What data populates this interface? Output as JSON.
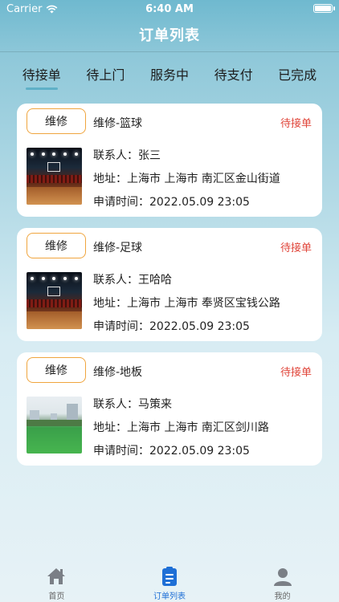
{
  "status_bar": {
    "carrier": "Carrier",
    "time": "6:40 AM"
  },
  "nav": {
    "title": "订单列表"
  },
  "tabs": [
    {
      "label": "待接单",
      "active": true
    },
    {
      "label": "待上门",
      "active": false
    },
    {
      "label": "服务中",
      "active": false
    },
    {
      "label": "待支付",
      "active": false
    },
    {
      "label": "已完成",
      "active": false
    }
  ],
  "orders": [
    {
      "type_label": "维修",
      "title": "维修-篮球",
      "status": "待接单",
      "contact": "联系人：张三",
      "address": "地址：上海市 上海市 南汇区金山街道",
      "time": "申请时间：2022.05.09 23:05",
      "image": "basketball-arena"
    },
    {
      "type_label": "维修",
      "title": "维修-足球",
      "status": "待接单",
      "contact": "联系人：王哈哈",
      "address": "地址：上海市 上海市 奉贤区宝钱公路",
      "time": "申请时间：2022.05.09 23:05",
      "image": "basketball-arena"
    },
    {
      "type_label": "维修",
      "title": "维修-地板",
      "status": "待接单",
      "contact": "联系人：马策来",
      "address": "地址：上海市 上海市 南汇区剑川路",
      "time": "申请时间：2022.05.09 23:05",
      "image": "football-field"
    }
  ],
  "tabbar": [
    {
      "label": "首页",
      "icon": "home-icon"
    },
    {
      "label": "订单列表",
      "icon": "order-list-icon",
      "active": true
    },
    {
      "label": "我的",
      "icon": "profile-icon"
    }
  ],
  "colors": {
    "accent": "#5fb0c7",
    "status": "#e0453a",
    "type_border": "#f0a53e",
    "tab_active": "#1e6fd6"
  }
}
